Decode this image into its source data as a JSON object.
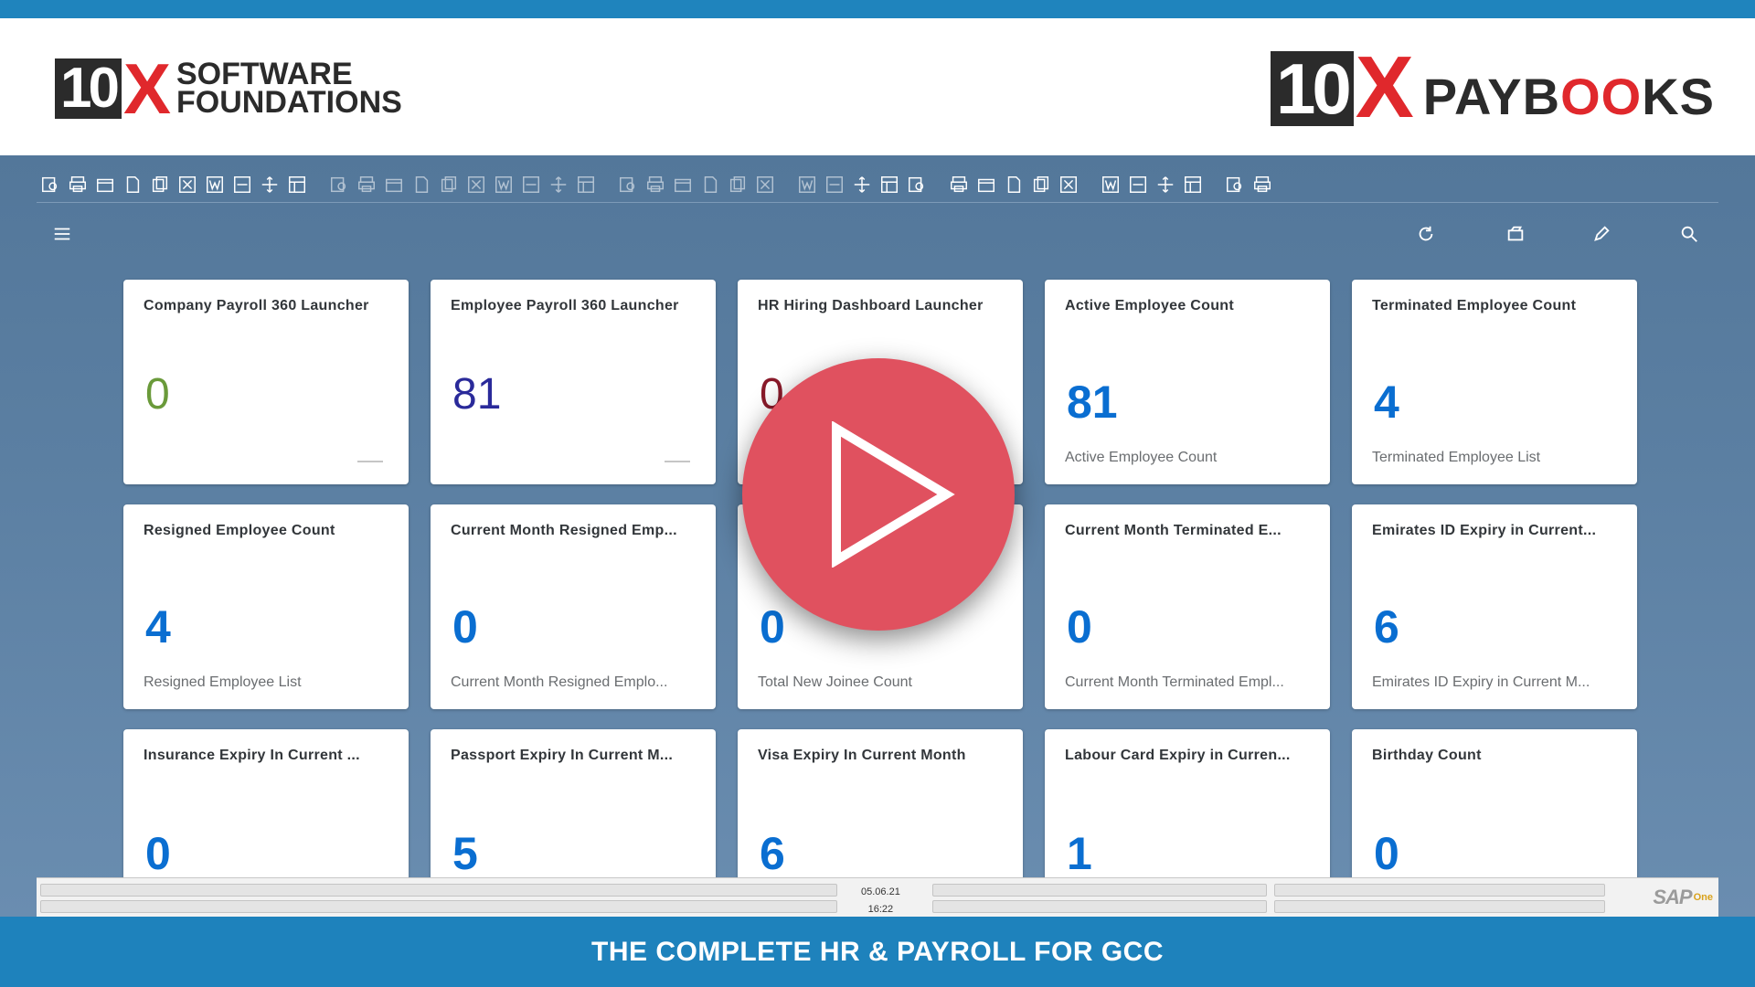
{
  "header": {
    "left_logo": {
      "mark_number": "10",
      "mark_letter": "X",
      "line1": "SOFTWARE",
      "line2": "FOUNDATIONS"
    },
    "right_logo": {
      "mark_number": "10",
      "mark_letter": "X",
      "word_start": "PAYB",
      "word_oo": "OO",
      "word_end": "KS"
    }
  },
  "toolbar": {
    "icons": [
      "find-icon",
      "print-icon",
      "print-preview-icon",
      "document-icon",
      "copy-icon",
      "export-excel-icon",
      "export-word-icon",
      "pdf-icon",
      "move-icon",
      "layout-icon",
      "form-icon",
      "open-icon",
      "first-record-icon",
      "previous-record-icon",
      "next-record-icon",
      "last-record-icon",
      "refresh-icon",
      "filter-icon",
      "sort-icon",
      "add-row-icon",
      "delete-row-icon",
      "duplicate-icon",
      "search-icon",
      "settings-icon",
      "base-document-icon",
      "target-document-icon",
      "journal-icon",
      "edit-icon",
      "calendar-icon",
      "message-icon",
      "chat-icon",
      "alert-icon",
      "report-icon",
      "calculator-icon",
      "org-icon",
      "user-icon",
      "window-icon",
      "split-icon",
      "chart-icon",
      "analytics-icon",
      "web-icon",
      "help-icon"
    ]
  },
  "shellbar": {
    "menu_icon": "hamburger-icon",
    "refresh_icon": "refresh-icon",
    "cards_icon": "cards-icon",
    "edit_icon": "pencil-icon",
    "search_icon": "search-icon"
  },
  "tiles": [
    {
      "title": "Company Payroll 360 Launcher",
      "value": "0",
      "footer": "",
      "value_color": "#6a9a3a",
      "style": "launcher"
    },
    {
      "title": "Employee Payroll 360 Launcher",
      "value": "81",
      "footer": "",
      "value_color": "#2a2a9a",
      "style": "launcher"
    },
    {
      "title": "HR Hiring Dashboard Launcher",
      "value": "0",
      "footer": "",
      "value_color": "#8a1a2a",
      "style": "launcher"
    },
    {
      "title": "Active Employee Count",
      "value": "81",
      "footer": "Active Employee Count",
      "value_color": "#0a6ed1",
      "style": "kpi"
    },
    {
      "title": "Terminated Employee Count",
      "value": "4",
      "footer": "Terminated Employee List",
      "value_color": "#0a6ed1",
      "style": "kpi"
    },
    {
      "title": "Resigned Employee Count",
      "value": "4",
      "footer": "Resigned Employee List",
      "value_color": "#0a6ed1",
      "style": "kpi"
    },
    {
      "title": "Current Month Resigned Emp...",
      "value": "0",
      "footer": "Current Month Resigned Emplo...",
      "value_color": "#0a6ed1",
      "style": "kpi"
    },
    {
      "title": "",
      "value": "0",
      "footer": "Total New Joinee Count",
      "value_color": "#0a6ed1",
      "style": "kpi"
    },
    {
      "title": "Current Month Terminated E...",
      "value": "0",
      "footer": "Current Month Terminated Empl...",
      "value_color": "#0a6ed1",
      "style": "kpi"
    },
    {
      "title": "Emirates ID Expiry in Current...",
      "value": "6",
      "footer": "Emirates ID Expiry in Current M...",
      "value_color": "#0a6ed1",
      "style": "kpi"
    },
    {
      "title": "Insurance Expiry In Current ...",
      "value": "0",
      "footer": "",
      "value_color": "#0a6ed1",
      "style": "kpi"
    },
    {
      "title": "Passport Expiry In Current M...",
      "value": "5",
      "footer": "",
      "value_color": "#0a6ed1",
      "style": "kpi"
    },
    {
      "title": "Visa Expiry In Current Month",
      "value": "6",
      "footer": "",
      "value_color": "#0a6ed1",
      "style": "kpi"
    },
    {
      "title": "Labour Card Expiry in Curren...",
      "value": "1",
      "footer": "",
      "value_color": "#0a6ed1",
      "style": "kpi"
    },
    {
      "title": "Birthday Count",
      "value": "0",
      "footer": "",
      "value_color": "#0a6ed1",
      "style": "kpi"
    }
  ],
  "statusbar": {
    "date": "05.06.21",
    "time": "16:22",
    "brand": "SAP",
    "brand_sub": "One"
  },
  "video": {
    "play_icon": "play-icon",
    "accent": "#e0515f"
  },
  "footer": {
    "tagline": "THE COMPLETE HR & PAYROLL FOR GCC"
  }
}
